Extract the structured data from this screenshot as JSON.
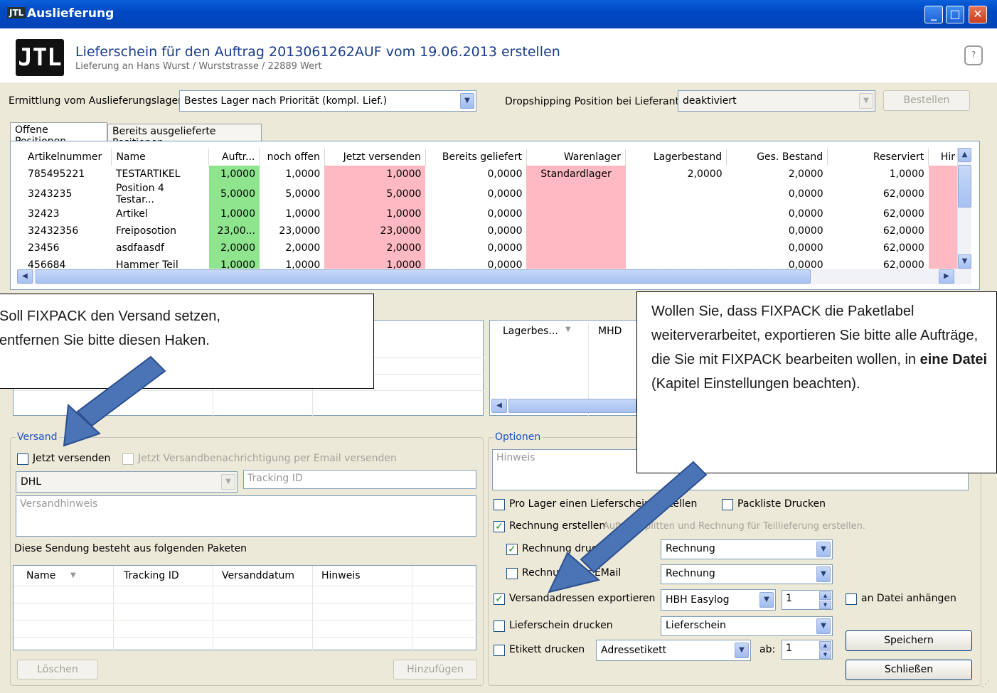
{
  "window": {
    "title": "Auslieferung",
    "icon": "JTL"
  },
  "header": {
    "logo": "JTL",
    "title": "Lieferschein für den Auftrag 2013061262AUF vom  19.06.2013 erstellen",
    "subtitle": "Lieferung an Hans Wurst / Wurststrasse / 22889 Wert"
  },
  "top": {
    "lager_label": "Ermittlung vom Auslieferungslager:",
    "lager_value": "Bestes Lager nach Priorität (kompl. Lief.)",
    "drop_label": "Dropshipping Position bei Lieferant",
    "drop_value": "deaktiviert",
    "bestellen": "Bestellen"
  },
  "tabs": [
    "Offene Positionen",
    "Bereits ausgelieferte Positionen"
  ],
  "positions": {
    "headers": [
      "Artikelnummer",
      "Name",
      "Auftr...",
      "noch offen",
      "Jetzt versenden",
      "Bereits geliefert",
      "Warenlager",
      "Lagerbestand",
      "Ges. Bestand",
      "Reserviert",
      "Hir"
    ],
    "rows": [
      [
        "785495221",
        "TESTARTIKEL",
        "1,0000",
        "1,0000",
        "1,0000",
        "0,0000",
        "Standardlager",
        "2,0000",
        "2,0000",
        "1,0000"
      ],
      [
        "3243235",
        "Position 4 Testar...",
        "5,0000",
        "5,0000",
        "5,0000",
        "0,0000",
        "",
        "",
        "0,0000",
        "62,0000"
      ],
      [
        "32423",
        "Artikel",
        "1,0000",
        "1,0000",
        "1,0000",
        "0,0000",
        "",
        "",
        "0,0000",
        "62,0000"
      ],
      [
        "32432356",
        "Freiposotion",
        "23,00...",
        "23,0000",
        "23,0000",
        "0,0000",
        "",
        "",
        "0,0000",
        "62,0000"
      ],
      [
        "23456",
        "asdfaasdf",
        "2,0000",
        "2,0000",
        "2,0000",
        "0,0000",
        "",
        "",
        "0,0000",
        "62,0000"
      ],
      [
        "456684",
        "Hammer Teil",
        "1,0000",
        "1,0000",
        "1,0000",
        "0,0000",
        "",
        "",
        "0,0000",
        "62,0000"
      ]
    ]
  },
  "lagergrid": {
    "headers": [
      "Lagerbes...",
      "MHD"
    ]
  },
  "versand": {
    "group": "Versand",
    "jetzt": "Jetzt versenden",
    "email": "Jetzt Versandbenachrichtigung per Email versenden",
    "carrier": "DHL",
    "tracking_placeholder": "Tracking ID",
    "hinweis_placeholder": "Versandhinweis",
    "pakete_label": "Diese Sendung besteht aus folgenden Paketen",
    "pakete_headers": [
      "Name",
      "Tracking ID",
      "Versanddatum",
      "Hinweis"
    ],
    "loeschen": "Löschen",
    "hinzufuegen": "Hinzufügen"
  },
  "optionen": {
    "group": "Optionen",
    "hinweis_placeholder": "Hinweis",
    "pro_lager": "Pro Lager einen Lieferschein erstellen",
    "packliste": "Packliste Drucken",
    "rechnung_erstellen": "Rechnung erstellen",
    "split": "Auftrag splitten und Rechnung für Teillieferung erstellen.",
    "rechnung_drucken": "Rechnung drucken",
    "rechnung_drucken_value": "Rechnung",
    "rechnung_email": "Rechnung per EMail",
    "rechnung_email_value": "Rechnung",
    "versand_export": "Versandadressen exportieren",
    "export_value": "HBH Easylog",
    "export_count": "1",
    "datei_anhaengen": "an Datei anhängen",
    "lieferschein": "Lieferschein drucken",
    "lieferschein_value": "Lieferschein",
    "etikett": "Etikett drucken",
    "etikett_value": "Adressetikett",
    "ab_label": "ab:",
    "ab_value": "1",
    "speichern": "Speichern",
    "schliessen": "Schließen"
  },
  "callouts": {
    "left": [
      "Soll FIXPACK den Versand setzen,",
      "entfernen Sie bitte diesen Haken."
    ],
    "right_1": "Wollen Sie, dass FIXPACK die Paketlabel weiterverarbeitet, exportieren Sie bitte alle Aufträge, die Sie mit FIXPACK bearbeiten wollen, in ",
    "right_bold": "eine Datei",
    "right_2": " (Kapitel Einstellungen beachten)."
  },
  "colors": {
    "accent": "#1a3d8c",
    "green": "#8ee58e",
    "pink": "#ffb9c2",
    "arrow": "#4a74b5"
  }
}
